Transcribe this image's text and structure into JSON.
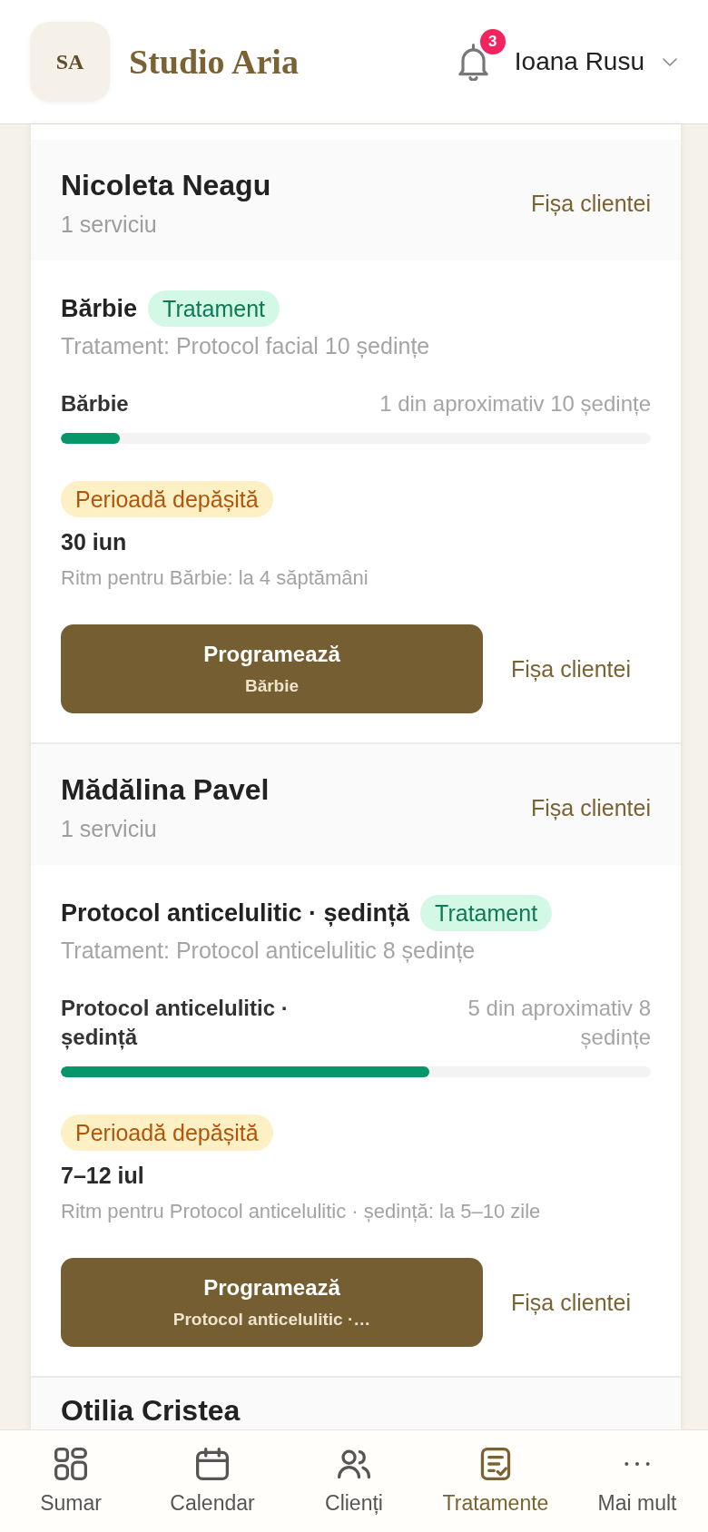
{
  "header": {
    "logo_initials": "SA",
    "brand": "Studio Aria",
    "notification_count": "3",
    "user_name": "Ioana Rusu"
  },
  "clients": [
    {
      "name": "Nicoleta Neagu",
      "service_count": "1 serviciu",
      "profile_link": "Fișa clientei",
      "services": [
        {
          "title": "Bărbie",
          "tag": "Tratament",
          "subtitle": "Tratament: Protocol facial 10 ședințe",
          "progress": {
            "label": "Bărbie",
            "reading": "1 din aproximativ 10 ședințe",
            "level": 0.1
          },
          "status": "Perioadă depășită",
          "due": "30 iun",
          "rhythm": "Ritm pentru Bărbie: la 4 săptămâni",
          "book_button": {
            "label": "Programează",
            "detail": "Bărbie"
          },
          "profile_link": "Fișa clientei"
        }
      ]
    },
    {
      "name": "Mădălina Pavel",
      "service_count": "1 serviciu",
      "profile_link": "Fișa clientei",
      "services": [
        {
          "title": "Protocol anticelulitic · ședință",
          "tag": "Tratament",
          "subtitle": "Tratament: Protocol anticelulitic 8 ședințe",
          "progress": {
            "label": "Protocol anticelulitic · ședință",
            "reading": "5 din aproximativ 8 ședințe",
            "level": 0.625
          },
          "status": "Perioadă depășită",
          "due": "7–12 iul",
          "rhythm": "Ritm pentru Protocol anticelulitic · ședință: la 5–10 zile",
          "book_button": {
            "label": "Programează",
            "detail": "Protocol anticelulitic ·…"
          },
          "profile_link": "Fișa clientei"
        }
      ]
    },
    {
      "name": "Otilia Cristea"
    }
  ],
  "bottom_nav": [
    {
      "label": "Sumar",
      "selected": false
    },
    {
      "label": "Calendar",
      "selected": false
    },
    {
      "label": "Clienți",
      "selected": false
    },
    {
      "label": "Tratamente",
      "selected": true
    },
    {
      "label": "Mai mult",
      "selected": false
    }
  ]
}
